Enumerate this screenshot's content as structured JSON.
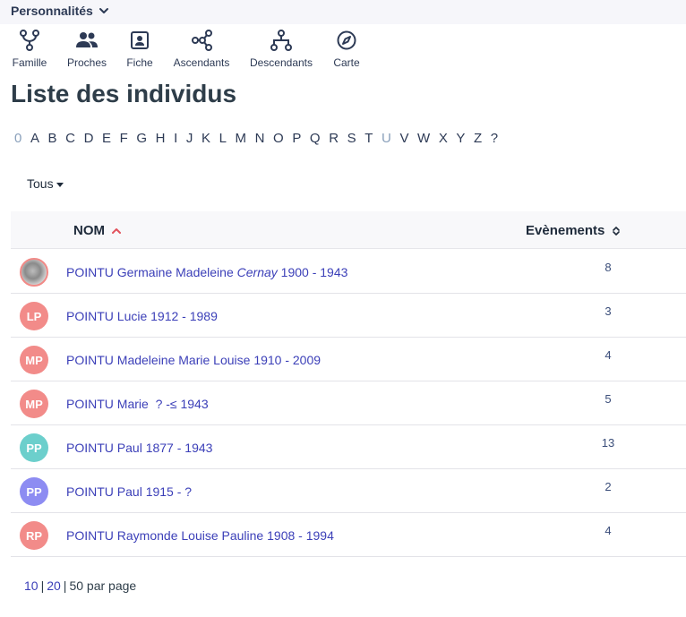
{
  "header": {
    "section_label": "Personnalités"
  },
  "nav": [
    {
      "label": "Famille",
      "icon": "family-fork-icon"
    },
    {
      "label": "Proches",
      "icon": "people-icon"
    },
    {
      "label": "Fiche",
      "icon": "id-card-icon"
    },
    {
      "label": "Ascendants",
      "icon": "ancestors-graph-icon"
    },
    {
      "label": "Descendants",
      "icon": "descendants-tree-icon"
    },
    {
      "label": "Carte",
      "icon": "compass-icon"
    }
  ],
  "page": {
    "title": "Liste des individus"
  },
  "alphabet": [
    "0",
    "A",
    "B",
    "C",
    "D",
    "E",
    "F",
    "G",
    "H",
    "I",
    "J",
    "K",
    "L",
    "M",
    "N",
    "O",
    "P",
    "Q",
    "R",
    "S",
    "T",
    "U",
    "V",
    "W",
    "X",
    "Y",
    "Z",
    "?"
  ],
  "alphabet_dimmed": [
    "0",
    "U"
  ],
  "filter": {
    "label": "Tous"
  },
  "table": {
    "col_name": "NOM",
    "col_events": "Evènements",
    "rows": [
      {
        "avatar": "",
        "avatar_color": "photo",
        "name": "POINTU Germaine Madeleine",
        "alias": "Cernay",
        "dates": "1900 - 1943",
        "events": "8"
      },
      {
        "avatar": "LP",
        "avatar_color": "#f28b89",
        "name": "POINTU Lucie",
        "alias": "",
        "dates": "1912 - 1989",
        "events": "3"
      },
      {
        "avatar": "MP",
        "avatar_color": "#f28b89",
        "name": "POINTU Madeleine Marie Louise",
        "alias": "",
        "dates": "1910 - 2009",
        "events": "4"
      },
      {
        "avatar": "MP",
        "avatar_color": "#f28b89",
        "name": "POINTU Marie",
        "alias": "",
        "dates": " ? -≤ 1943",
        "events": "5"
      },
      {
        "avatar": "PP",
        "avatar_color": "#6ccfcc",
        "name": "POINTU Paul",
        "alias": "",
        "dates": "1877 - 1943",
        "events": "13"
      },
      {
        "avatar": "PP",
        "avatar_color": "#8d8cf2",
        "name": "POINTU Paul",
        "alias": "",
        "dates": "1915 - ?",
        "events": "2"
      },
      {
        "avatar": "RP",
        "avatar_color": "#f28b89",
        "name": "POINTU Raymonde Louise Pauline",
        "alias": "",
        "dates": "1908 - 1994",
        "events": "4"
      }
    ]
  },
  "pagination": {
    "opt1": "10",
    "opt2": "20",
    "current": "50",
    "suffix": "par page"
  },
  "colors": {
    "accent": "#3b3fb8",
    "sort_active": "#e2525c",
    "icon": "#2d3a55"
  }
}
